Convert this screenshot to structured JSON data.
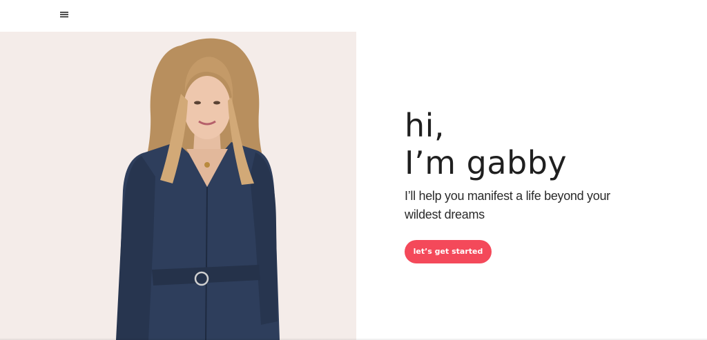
{
  "nav": {
    "menu_icon": "hamburger-menu-icon"
  },
  "hero": {
    "image_description_icon": "portrait-photo",
    "background_color": "#f4ece9",
    "headline_line1": "hi,",
    "headline_line2": "I’m gabby",
    "subtitle": "I’ll help you manifest a life beyond your wildest dreams",
    "cta_label": "let’s get started",
    "cta_color": "#f4495a"
  }
}
